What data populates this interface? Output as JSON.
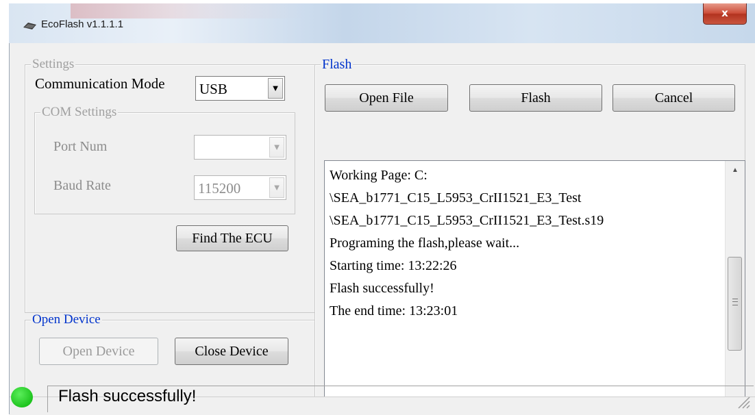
{
  "window": {
    "title": "EcoFlash v1.1.1.1",
    "close_label": "x"
  },
  "settings": {
    "legend": "Settings",
    "comm_mode_label": "Communication Mode",
    "comm_mode_value": "USB",
    "com_settings": {
      "legend": "COM Settings",
      "port_label": "Port Num",
      "port_value": "",
      "baud_label": "Baud Rate",
      "baud_value": "115200"
    },
    "find_button": "Find The ECU"
  },
  "open_device": {
    "legend": "Open Device",
    "open_button": "Open Device",
    "close_button": "Close Device"
  },
  "flash": {
    "legend": "Flash",
    "open_file_button": "Open File",
    "flash_button": "Flash",
    "cancel_button": "Cancel",
    "log": [
      "Working Page: C:",
      "\\SEA_b1771_C15_L5953_CrII1521_E3_Test",
      "\\SEA_b1771_C15_L5953_CrII1521_E3_Test.s19",
      "Programing the flash,please wait...",
      "Starting time: 13:22:26",
      "Flash successfully!",
      "The end time: 13:23:01"
    ]
  },
  "status": {
    "text": "Flash successfully!",
    "led_color": "#1fc41f"
  },
  "icons": {
    "app": "chip-icon",
    "dropdown": "chevron-down-icon",
    "scroll_up": "scroll-up-icon",
    "scroll_down": "scroll-down-icon",
    "grip": "resize-grip-icon"
  }
}
